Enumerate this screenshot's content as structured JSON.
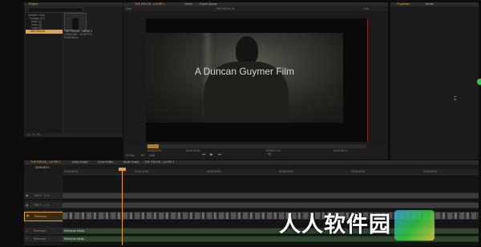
{
  "project_panel": {
    "tab_label": "Project",
    "search_placeholder": "",
    "tree": [
      {
        "label": "Untitled / DAN",
        "selected": false
      },
      {
        "label": "Footage (27)",
        "selected": false
      },
      {
        "label": "Video (1)",
        "selected": false
      },
      {
        "label": "Video (2)",
        "selected": false
      },
      {
        "label": "Video (3)",
        "selected": false
      },
      {
        "label": "THE FIELDS",
        "selected": true
      }
    ],
    "item_title": "THE FIELDS - LAYER 1",
    "item_meta": [
      "1920x1080 - 25.00 FPS",
      "00:00:58:10"
    ]
  },
  "viewer": {
    "tabs": [
      "THE FIELDS - LAYER 1",
      "Viewer",
      "Export Queue"
    ],
    "toolbar_left": "Cine",
    "toolbar_mid": "THE FIELDS 01",
    "toolbar_right": "Full",
    "film_title": "A Duncan Guymer Film",
    "timecodes": [
      "00:00:00:00",
      "00:00:00:00",
      "00:00:07:10",
      "00:00:58:10"
    ],
    "bottom_left": [
      "Fit Size",
      "FX",
      "Orbit"
    ]
  },
  "properties_panel": {
    "tabs": [
      "Properties",
      "Media"
    ]
  },
  "timeline": {
    "tabs": [
      "THE FIELDS - LAYER 1",
      "Audio Graph",
      "Curve Editor",
      "Node Graph",
      "THE FIELDS - LAYER 1"
    ],
    "current_time": "00:00:58:10",
    "ruler_marks": [
      "00:00:00:00",
      "00:00:10:00",
      "00:00:20:00",
      "00:00:30:00",
      "00:00:40:00",
      "00:00:50:00"
    ],
    "tracks": [
      {
        "label": "THE F... 3 / 3",
        "highlight": false
      },
      {
        "label": "THE F... 2 / 3",
        "highlight": false
      },
      {
        "label": "Reference",
        "highlight": true
      },
      {
        "label": "Reference",
        "highlight": false
      },
      {
        "label": "Reference",
        "highlight": false
      }
    ],
    "track_suffix": "Reference Media"
  },
  "watermark": {
    "text": "人人软件园"
  },
  "colors": {
    "accent": "#e8a040",
    "playhead": "#d03030",
    "bg": "#0d0d0d",
    "panel": "#1e1e1e",
    "green_dot": "#2ecc40"
  }
}
